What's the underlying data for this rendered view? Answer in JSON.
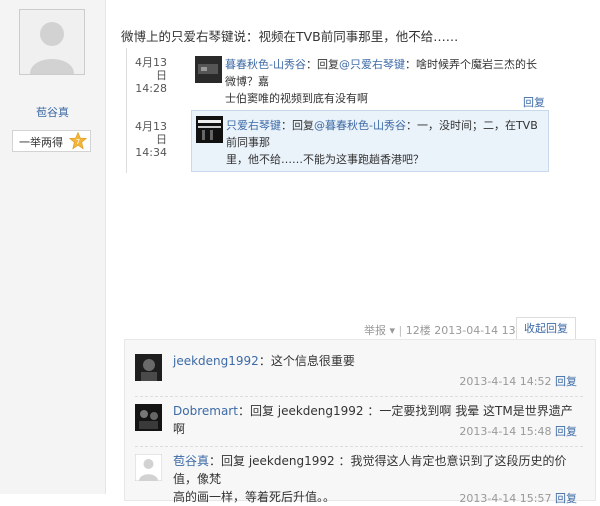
{
  "author": {
    "name": "苞谷真",
    "badge_label": "一举两得",
    "badge_level": "7"
  },
  "post": {
    "text": "微博上的只爱右琴键说：视频在TVB前同事那里，他不给……"
  },
  "comments": [
    {
      "date": "4月13日",
      "time": "14:28",
      "user": "暮春秋色-山秀谷",
      "body_prefix": "：回复",
      "mention": "@只爱右琴键",
      "body_line1": "：啥时候弄个魔岩三杰的长微博？嘉",
      "body_line2": "士伯窦唯的视频到底有没有啊",
      "reply": "回复"
    },
    {
      "date": "4月13日",
      "time": "14:34",
      "user": "只爱右琴键",
      "body_prefix": "：回复",
      "mention": "@暮春秋色-山秀谷",
      "body_line1": "：一，没时间；二，在TVB前同事那",
      "body_line2": "里，他不给……不能为这事跑趟香港吧？",
      "reply": "回复"
    }
  ],
  "meta": {
    "report": "举报",
    "floor": "12楼",
    "datetime": "2013-04-14 13:59",
    "collapse": "收起回复"
  },
  "replies": [
    {
      "user": "jeekdeng1992",
      "text": "：这个信息很重要",
      "time": "2013-4-14 14:52",
      "reply": "回复"
    },
    {
      "user": "Dobremart",
      "text": "：回复 jeekdeng1992 ：一定要找到啊 我晕 这TM是世界遗产啊",
      "time": "2013-4-14 15:48",
      "reply": "回复"
    },
    {
      "user": "苞谷真",
      "text_line1": "：回复 jeekdeng1992 ：我觉得这人肯定也意识到了这段历史的价值，像梵",
      "text_line2": "高的画一样，等着死后升值。。",
      "time": "2013-4-14 15:57",
      "reply": "回复"
    }
  ]
}
